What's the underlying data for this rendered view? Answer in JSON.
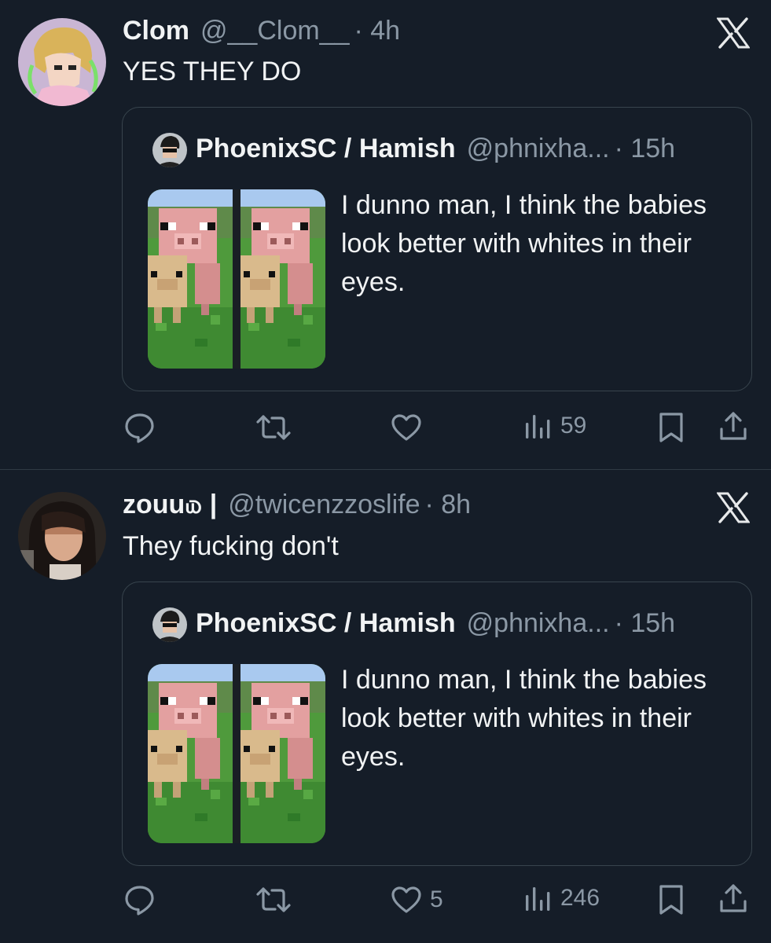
{
  "tweets": [
    {
      "name": "Clom",
      "handle": "@__Clom__",
      "time": "· 4h",
      "text": "YES THEY DO",
      "quote": {
        "name": "PhoenixSC / Hamish",
        "handle": "@phnixha...",
        "time": "· 15h",
        "text": "I dunno man, I think the babies look better with whites in their eyes."
      },
      "actions": {
        "likes": "",
        "views": "59"
      }
    },
    {
      "name": "zouu௰ |",
      "handle": "@twicenzzoslife",
      "time": "· 8h",
      "text": "They fucking don't",
      "quote": {
        "name": "PhoenixSC / Hamish",
        "handle": "@phnixha...",
        "time": "· 15h",
        "text": "I dunno man, I think the babies look better with whites in their eyes."
      },
      "actions": {
        "likes": "5",
        "views": "246"
      }
    }
  ],
  "icons": {
    "reply": "reply-icon",
    "retweet": "retweet-icon",
    "like": "heart-icon",
    "views": "views-icon",
    "bookmark": "bookmark-icon",
    "share": "share-icon",
    "brand": "x-logo-icon"
  },
  "colors": {
    "background": "#151d28",
    "muted": "#8b98a5",
    "border": "#38444d"
  }
}
